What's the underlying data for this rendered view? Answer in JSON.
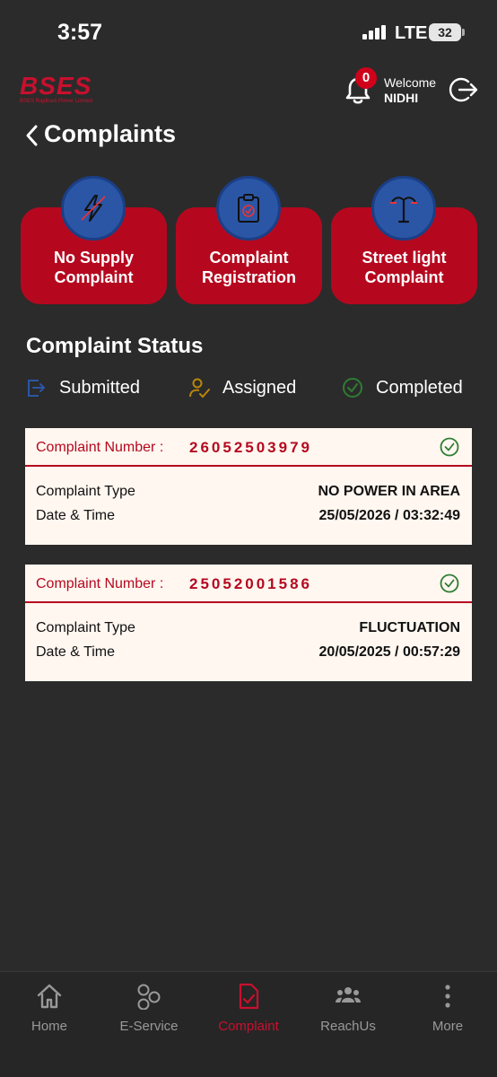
{
  "status_bar": {
    "time": "3:57",
    "network": "LTE",
    "battery": "32"
  },
  "header": {
    "logo": "BSES",
    "logo_tagline": "BSES Rajdhani Power Limited",
    "notification_count": "0",
    "welcome": "Welcome",
    "username": "NIDHI"
  },
  "page": {
    "title": "Complaints"
  },
  "services": [
    {
      "line1": "No Supply",
      "line2": "Complaint",
      "icon": "lightning-icon"
    },
    {
      "line1": "Complaint",
      "line2": "Registration",
      "icon": "clipboard-icon"
    },
    {
      "line1": "Street light",
      "line2": "Complaint",
      "icon": "street-light-icon"
    }
  ],
  "status_section": {
    "title": "Complaint Status",
    "legend": [
      {
        "label": "Submitted",
        "icon": "submitted-icon",
        "color": "#2b56a6"
      },
      {
        "label": "Assigned",
        "icon": "assigned-icon",
        "color": "#b8860b"
      },
      {
        "label": "Completed",
        "icon": "completed-icon",
        "color": "#2e7d32"
      }
    ]
  },
  "complaints": [
    {
      "number_label": "Complaint Number :",
      "number": "26052503979",
      "type_label": "Complaint Type",
      "type": "NO POWER IN AREA",
      "date_label": "Date & Time",
      "date": "25/05/2026 / 03:32:49",
      "status": "completed"
    },
    {
      "number_label": "Complaint Number :",
      "number": "25052001586",
      "type_label": "Complaint Type",
      "type": "FLUCTUATION",
      "date_label": "Date & Time",
      "date": "20/05/2025 / 00:57:29",
      "status": "completed"
    }
  ],
  "bottom_nav": [
    {
      "label": "Home",
      "icon": "home-icon"
    },
    {
      "label": "E-Service",
      "icon": "e-service-icon"
    },
    {
      "label": "Complaint",
      "icon": "complaint-icon",
      "active": true
    },
    {
      "label": "ReachUs",
      "icon": "reachus-icon"
    },
    {
      "label": "More",
      "icon": "more-icon"
    }
  ],
  "colors": {
    "background": "#2b2b2b",
    "brand_red": "#b5081f",
    "icon_blue": "#2b56a6",
    "card_background": "#fff7f0"
  }
}
